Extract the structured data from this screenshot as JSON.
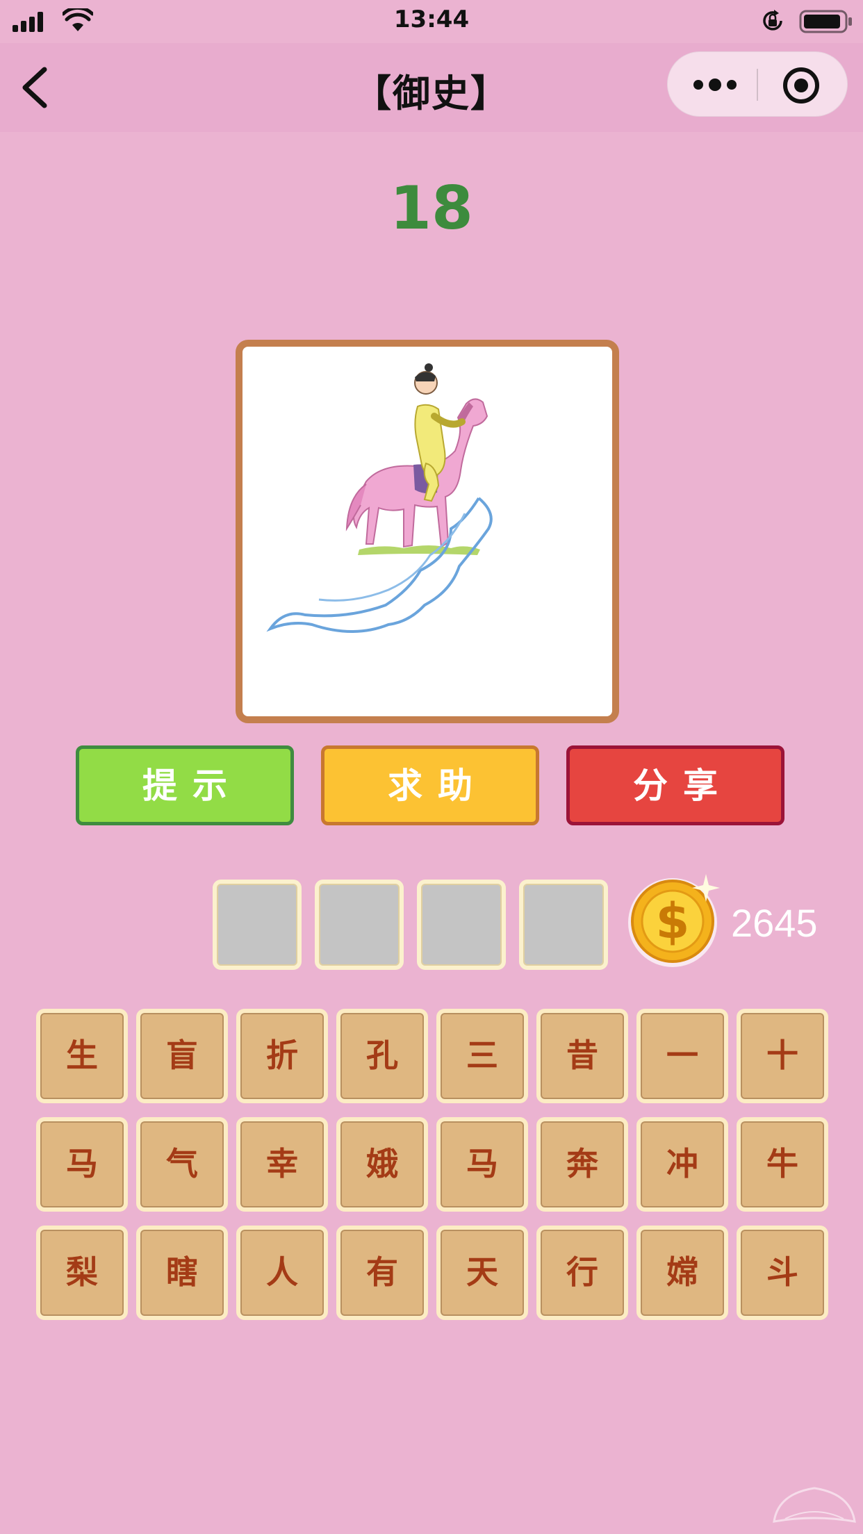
{
  "status_bar": {
    "time": "13:44"
  },
  "nav": {
    "title": "【御史】"
  },
  "level": "18",
  "buttons": {
    "hint": "提示",
    "help": "求助",
    "share": "分享"
  },
  "answer_slots": [
    "",
    "",
    "",
    ""
  ],
  "coins": "2645",
  "tiles": [
    "生",
    "盲",
    "折",
    "孔",
    "三",
    "昔",
    "一",
    "十",
    "马",
    "气",
    "幸",
    "娥",
    "马",
    "奔",
    "冲",
    "牛",
    "梨",
    "瞎",
    "人",
    "有",
    "天",
    "行",
    "嫦",
    "斗"
  ],
  "colors": {
    "background": "#ebb3d1",
    "level": "#3d8b3d",
    "hint": "#92dc46",
    "help": "#fcc233",
    "share": "#e64540",
    "tile": "#dfb781",
    "tile_text": "#a43b16"
  }
}
